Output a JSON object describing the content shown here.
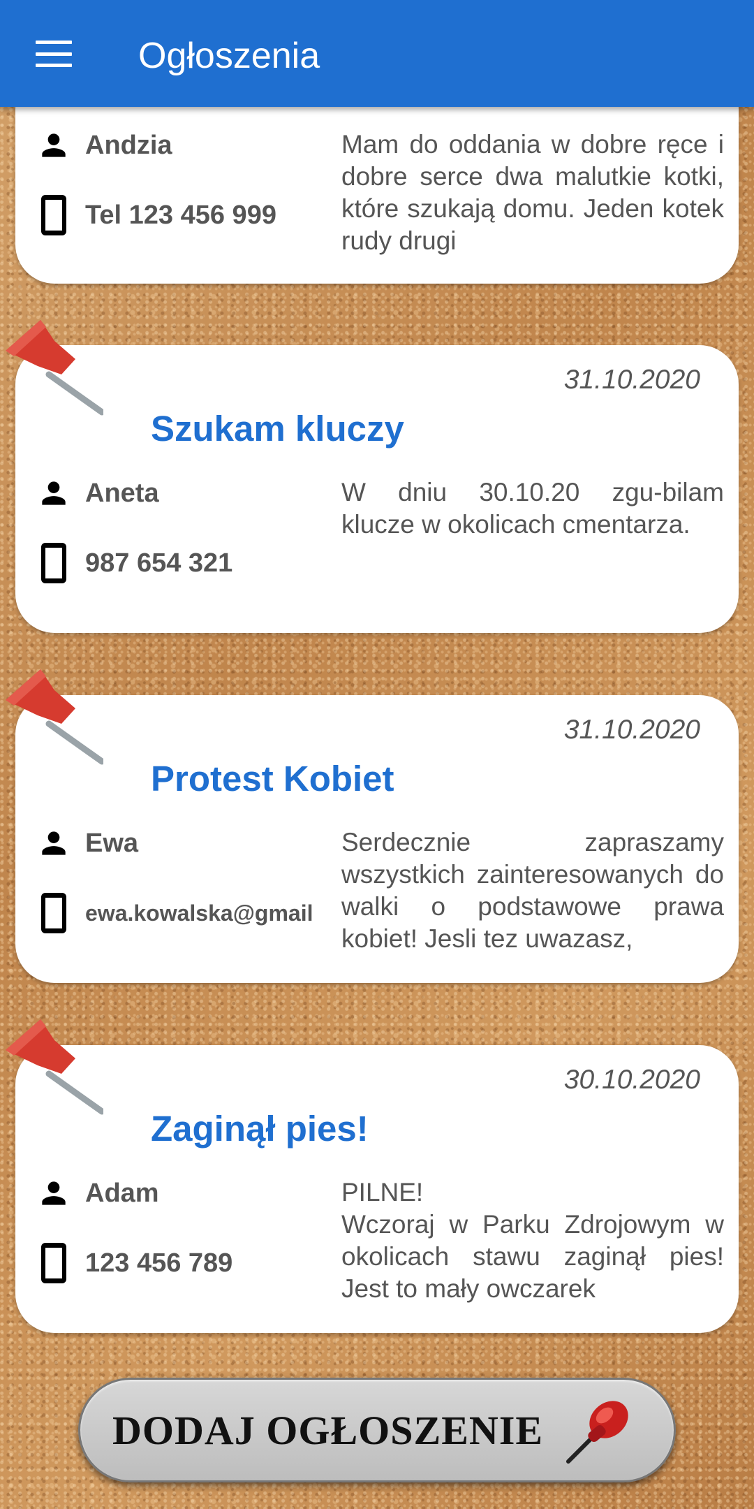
{
  "appbar": {
    "title": "Ogłoszenia"
  },
  "cards": [
    {
      "author": "Andzia",
      "contact": "Tel 123 456 999",
      "description": "Mam do oddania w dobre ręce i dobre serce dwa malutkie kotki, które szukają domu. Jeden kotek rudy drugi"
    },
    {
      "date": "31.10.2020",
      "title": "Szukam kluczy",
      "author": "Aneta",
      "contact": "987 654 321",
      "description": "W dniu 30.10.20 zgu-bilam klucze w okolicach cmentarza."
    },
    {
      "date": "31.10.2020",
      "title": "Protest Kobiet",
      "author": "Ewa",
      "contact": "ewa.kowalska@gmail",
      "description": "Serdecznie zapraszamy wszystkich zainteresowanych do walki o podstawowe prawa kobiet! Jesli tez uwazasz,"
    },
    {
      "date": "30.10.2020",
      "title": "Zaginął pies!",
      "author": "Adam",
      "contact": "123 456 789",
      "description_line1": "PILNE!",
      "description": "Wczoraj w Parku Zdrojowym w okolicach stawu zaginął pies! Jest to mały owczarek"
    }
  ],
  "add_button": {
    "label": "DODAJ OGŁOSZENIE"
  },
  "icons": {
    "menu": "hamburger-menu-icon",
    "person": "person-icon",
    "phone": "smartphone-icon",
    "pin": "push-pin-icon"
  },
  "colors": {
    "primary": "#1f6fd0",
    "pin_red": "#d63b2f",
    "text_gray": "#555555"
  }
}
